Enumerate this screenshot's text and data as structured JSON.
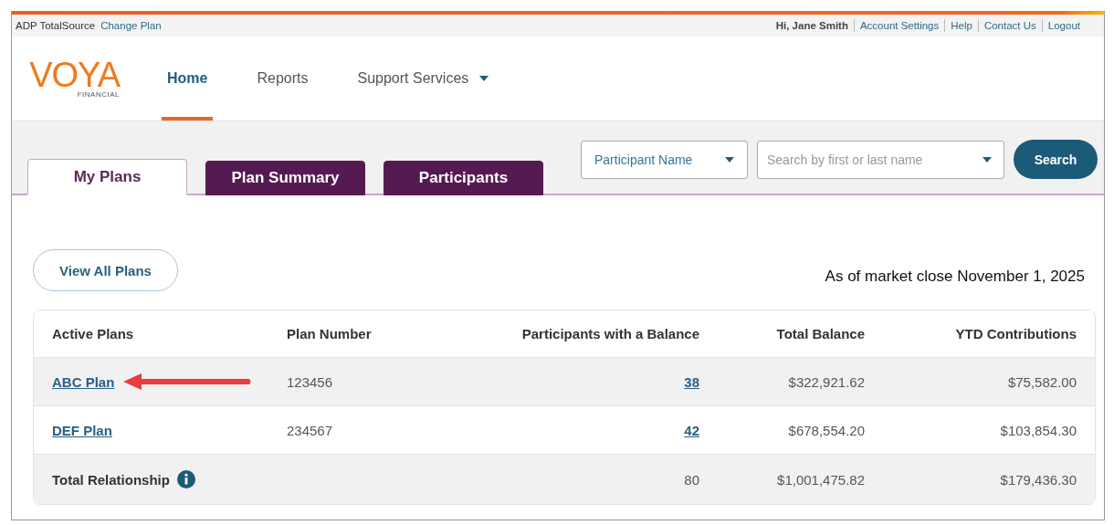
{
  "top_bar": {
    "company": "ADP TotalSource",
    "change_plan": "Change Plan",
    "greeting": "Hi, Jane Smith",
    "links": [
      "Account Settings",
      "Help",
      "Contact Us",
      "Logout"
    ]
  },
  "logo": {
    "name": "VOYA",
    "subtitle": "FINANCIAL"
  },
  "nav": [
    {
      "label": "Home",
      "selected": true,
      "has_menu": false
    },
    {
      "label": "Reports",
      "selected": false,
      "has_menu": false
    },
    {
      "label": "Support Services",
      "selected": false,
      "has_menu": true
    }
  ],
  "tabs": [
    {
      "label": "My Plans",
      "selected": true
    },
    {
      "label": "Plan Summary",
      "selected": false
    },
    {
      "label": "Participants",
      "selected": false
    }
  ],
  "search": {
    "filter": "Participant Name",
    "placeholder": "Search by first or last name",
    "button": "Search"
  },
  "view_all_button": "View All Plans",
  "as_of": "As of market close November 1, 2025",
  "table": {
    "columns": [
      "Active Plans",
      "Plan Number",
      "Participants with a Balance",
      "Total Balance",
      "YTD Contributions"
    ],
    "rows": [
      {
        "kind": "plan",
        "pointed": true,
        "cells": [
          "ABC Plan",
          "123456",
          "38",
          "$322,921.62",
          "$75,582.00"
        ]
      },
      {
        "kind": "plan",
        "pointed": false,
        "cells": [
          "DEF Plan",
          "234567",
          "42",
          "$678,554.20",
          "$103,854.30"
        ]
      },
      {
        "kind": "total",
        "pointed": false,
        "cells": [
          "Total Relationship",
          "",
          "80",
          "$1,001,475.82",
          "$179,436.30"
        ]
      }
    ]
  }
}
